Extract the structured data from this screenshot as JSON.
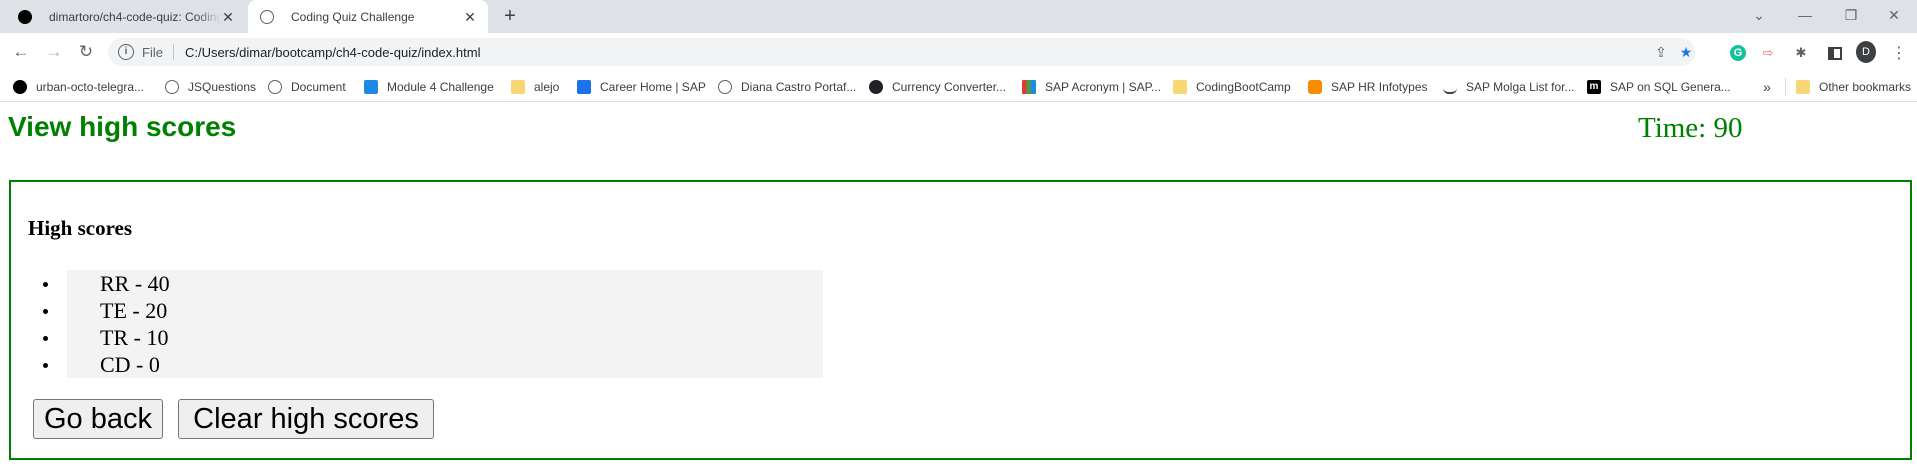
{
  "browser": {
    "tabs": [
      {
        "title": "dimartoro/ch4-code-quiz: Coding Quiz Challenge",
        "icon": "github-icon"
      },
      {
        "title": "Coding Quiz Challenge",
        "icon": "globe-icon"
      }
    ],
    "new_tab": "+",
    "window_controls": {
      "tab_search": "⌄",
      "minimize": "—",
      "restore": "❐",
      "close": "✕"
    },
    "omnibox": {
      "scheme_label": "File",
      "url": "C:/Users/dimar/bootcamp/ch4-code-quiz/index.html"
    },
    "profile_initial": "D",
    "bookmarks": [
      {
        "label": "urban-octo-telegra...",
        "icon": "github-icon"
      },
      {
        "label": "JSQuestions",
        "icon": "globe-icon"
      },
      {
        "label": "Document",
        "icon": "globe-icon"
      },
      {
        "label": "Module 4 Challenge",
        "icon": "doc-icon"
      },
      {
        "label": "alejo",
        "icon": "folder-icon"
      },
      {
        "label": "Career Home | SAP",
        "icon": "sap-icon"
      },
      {
        "label": "Diana Castro Portaf...",
        "icon": "globe-icon"
      },
      {
        "label": "Currency Converter...",
        "icon": "converter-icon"
      },
      {
        "label": "SAP Acronym | SAP...",
        "icon": "grid-icon"
      },
      {
        "label": "CodingBootCamp",
        "icon": "folder-icon"
      },
      {
        "label": "SAP HR Infotypes",
        "icon": "cube-icon"
      },
      {
        "label": "SAP Molga List for...",
        "icon": "pen-icon"
      },
      {
        "label": "SAP on SQL Genera...",
        "icon": "m-icon"
      }
    ],
    "more_bookmarks": "»",
    "other_bookmarks": "Other bookmarks"
  },
  "page": {
    "view_high_scores": "View high scores",
    "timer": "Time: 90",
    "heading": "High scores",
    "scores": [
      "RR - 40",
      "TE - 20",
      "TR - 10",
      "CD - 0"
    ],
    "buttons": {
      "back": "Go back",
      "clear": "Clear high scores"
    }
  },
  "colors": {
    "accent": "#008000",
    "list_bg": "#f3f3f3"
  }
}
